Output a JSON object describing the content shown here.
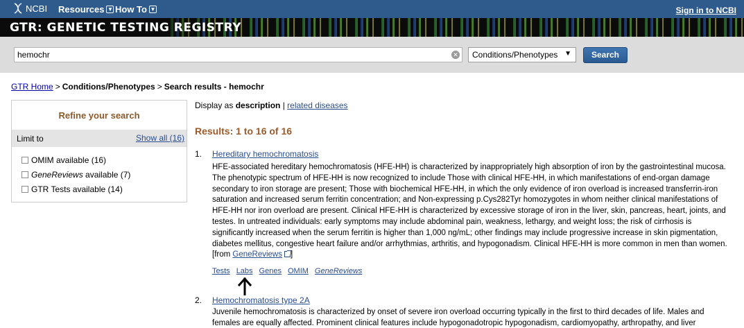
{
  "ncbi_bar": {
    "logo": "NCBI",
    "menus": [
      "Resources",
      "How To"
    ],
    "signin": "Sign in to NCBI"
  },
  "banner": {
    "title": "GTR: GENETIC TESTING REGISTRY"
  },
  "search": {
    "value": "hemochr",
    "database": "Conditions/Phenotypes",
    "button": "Search"
  },
  "breadcrumb": {
    "home": "GTR Home",
    "level2": "Conditions/Phenotypes",
    "current": "Search results - hemochr"
  },
  "sidebar": {
    "title": "Refine your search",
    "limit_label": "Limit to",
    "show_all": "Show all (16)",
    "filters": [
      "OMIM available (16)",
      "GeneReviews available (7)",
      "GTR Tests available (14)"
    ]
  },
  "display": {
    "prefix": "Display as ",
    "mode": "description",
    "separator": " | ",
    "alt_link": "related diseases"
  },
  "results_heading": "Results: 1 to 16 of 16",
  "results": [
    {
      "num": "1.",
      "title": "Hereditary hemochromatosis",
      "description": "HFE-associated hereditary hemochromatosis (HFE-HH) is characterized by inappropriately high absorption of iron by the gastrointestinal mucosa. The phenotypic spectrum of HFE-HH is now recognized to include Those with clinical HFE-HH, in which manifestations of end-organ damage secondary to iron storage are present; Those with biochemical HFE-HH, in which the only evidence of iron overload is increased transferrin-iron saturation and increased serum ferritin concentration; and Non-expressing p.Cys282Tyr homozygotes in whom neither clinical manifestations of HFE-HH nor iron overload are present. Clinical HFE-HH is characterized by excessive storage of iron in the liver, skin, pancreas, heart, joints, and testes. In untreated individuals: early symptoms may include abdominal pain, weakness, lethargy, and weight loss; the risk of cirrhosis is significantly increased when the serum ferritin is higher than 1,000 ng/mL; other findings may include progressive increase in skin pigmentation, diabetes mellitus, congestive heart failure and/or arrhythmias, arthritis, and hypogonadism. Clinical HFE-HH is more common in men than women. [from ",
      "source_link": "GeneReviews",
      "source_suffix": "]",
      "links": [
        "Tests",
        "Labs",
        "Genes",
        "OMIM",
        "GeneReviews"
      ]
    },
    {
      "num": "2.",
      "title": "Hemochromatosis type 2A",
      "description": "Juvenile hemochromatosis is characterized by onset of severe iron overload occurring typically in the first to third decades of life. Males and females are equally affected. Prominent clinical features include hypogonadotropic hypogonadism, cardiomyopathy, arthropathy, and liver"
    }
  ],
  "colors": {
    "ncbi_bar": "#2e5b8c",
    "search_area": "#dcdcdc",
    "heading_brown": "#9b5a2a",
    "link_blue": "#2a4d8f"
  }
}
